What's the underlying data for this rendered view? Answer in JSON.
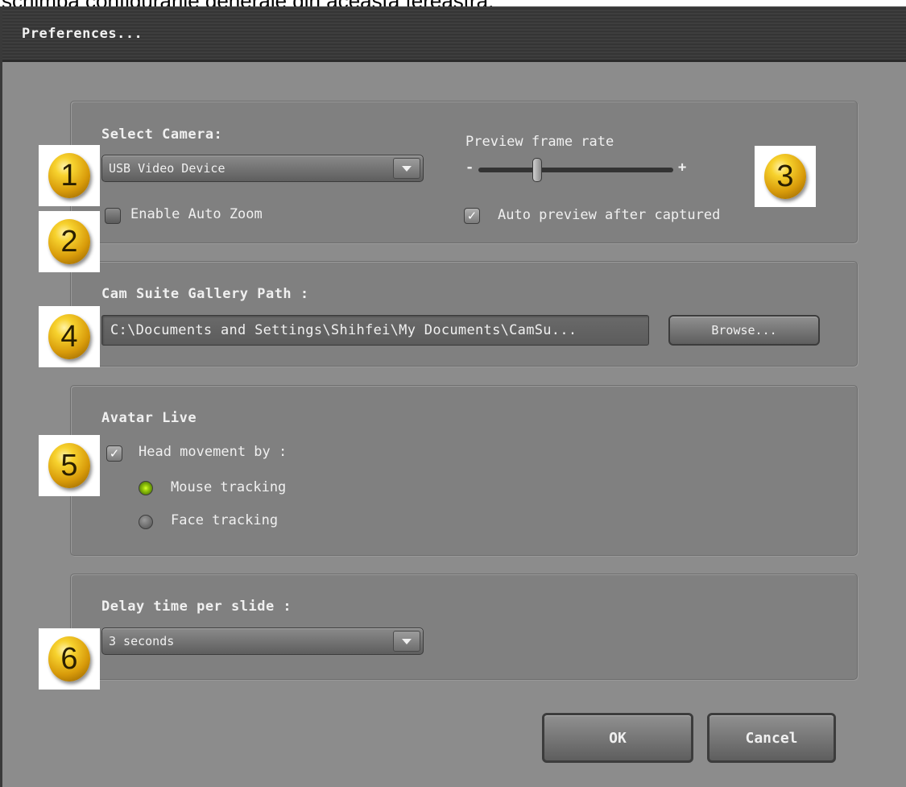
{
  "caption": "schimba configurarile generale din aceasta fereastra.",
  "window": {
    "title": "Preferences..."
  },
  "camera": {
    "title": "Select Camera:",
    "device": "USB Video Device",
    "auto_zoom_label": "Enable Auto Zoom",
    "auto_zoom_checked": false,
    "frame_rate_label": "Preview frame rate",
    "frame_rate_min": "-",
    "frame_rate_max": "+",
    "frame_rate_level": 0.3,
    "auto_preview_label": "Auto preview after captured",
    "auto_preview_checked": true
  },
  "gallery": {
    "title": "Cam Suite Gallery Path :",
    "path": "C:\\Documents and Settings\\Shihfei\\My Documents\\CamSu...",
    "browse_label": "Browse..."
  },
  "avatar": {
    "title": "Avatar Live",
    "head_label": "Head movement by :",
    "head_checked": true,
    "mouse_label": "Mouse tracking",
    "face_label": "Face tracking",
    "selected": "Mouse tracking"
  },
  "slides": {
    "title": "Delay time per slide :",
    "delay": "3 seconds"
  },
  "buttons": {
    "ok": "OK",
    "cancel": "Cancel"
  },
  "markers": [
    "1",
    "2",
    "3",
    "4",
    "5",
    "6"
  ],
  "colors": {
    "accent_radio": "#9ed20c",
    "badge": "#f7d22e",
    "panel": "#808080"
  }
}
